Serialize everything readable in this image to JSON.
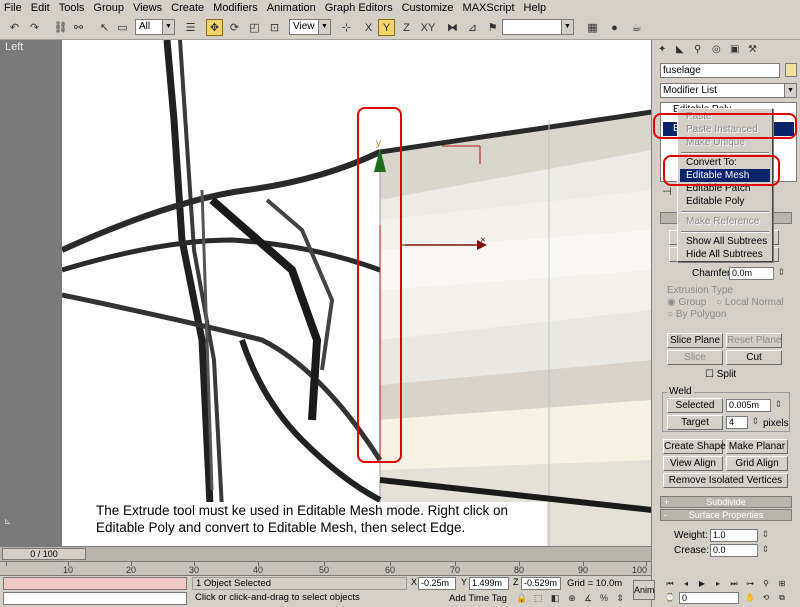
{
  "menu": [
    "File",
    "Edit",
    "Tools",
    "Group",
    "Views",
    "Create",
    "Modifiers",
    "Animation",
    "Graph Editors",
    "Customize",
    "MAXScript",
    "Help"
  ],
  "toolbar": {
    "selection_filter": "All",
    "ref_coord": "View",
    "axis_x": "X",
    "axis_y": "Y",
    "axis_z": "Z",
    "axis_xy": "XY"
  },
  "viewport": {
    "label": "Left",
    "gizmo_y": "y",
    "gizmo_x": "×",
    "instruction": "The Extrude tool must ke used in Editable Mesh mode.  Right click on Editable Poly and convert to Editable Mesh, then select Edge."
  },
  "command_panel": {
    "object_name": "fuselage",
    "object_color": "#f2e19d",
    "modifier_list": "Modifier List",
    "stack_top": "Editable Poly",
    "stack_selected": "Editable Poly"
  },
  "context_menu": {
    "paste": "Paste",
    "paste_instanced": "Paste Instanced",
    "make_unique": "Make Unique",
    "convert_to": "Convert To:",
    "editable_mesh": "Editable Mesh",
    "editable_patch": "Editable Patch",
    "editable_poly": "Editable Poly",
    "make_reference": "Make Reference",
    "show_all_subtrees": "Show All Subtrees",
    "hide_all_subtrees": "Hide All Subtrees"
  },
  "edit_geometry": {
    "chamfer_label": "Chamfer",
    "chamfer_value": "0.0m",
    "extrusion_type": "Extrusion Type",
    "group": "Group",
    "local_normal": "Local Normal",
    "by_polygon": "By Polygon",
    "slice_plane": "Slice Plane",
    "reset_plane": "Reset Plane",
    "slice": "Slice",
    "cut": "Cut",
    "split": "Split",
    "weld": "Weld",
    "selected": "Selected",
    "selected_value": "0.005m",
    "target": "Target",
    "target_value": "4",
    "pixels": "pixels",
    "create_shape": "Create Shape",
    "make_planar": "Make Planar",
    "view_align": "View Align",
    "grid_align": "Grid Align",
    "remove_isolated": "Remove Isolated Vertices"
  },
  "rollouts": {
    "subdivide": "Subdivide",
    "surface_properties": "Surface Properties",
    "plus": "+",
    "minus": "-"
  },
  "surface": {
    "weight_label": "Weight:",
    "weight_value": "1.0",
    "crease_label": "Crease:",
    "crease_value": "0.0"
  },
  "timeline": {
    "slider": "0 / 100",
    "ticks": [
      "10",
      "20",
      "30",
      "40",
      "50",
      "60",
      "70",
      "80",
      "90",
      "100"
    ]
  },
  "status": {
    "selected": "1 Object Selected",
    "prompt": "Click or click-and-drag to select objects",
    "x_label": "X",
    "x_value": "-0.25m",
    "y_label": "Y",
    "y_value": "1.499m",
    "z_label": "Z",
    "z_value": "-0.529m",
    "grid": "Grid = 10.0m",
    "add_time_tag": "Add Time Tag",
    "anim": "Anim",
    "frame": "0"
  }
}
